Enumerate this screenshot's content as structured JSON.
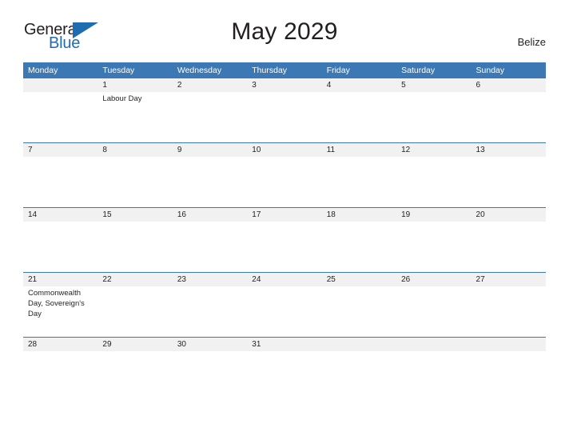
{
  "brand": {
    "name_part1": "General",
    "name_part2": "Blue",
    "triangle_color": "#1f6cb0"
  },
  "header": {
    "title": "May 2029",
    "country": "Belize"
  },
  "colors": {
    "header_blue": "#3c78b4",
    "date_band": "#f1f1f1",
    "text": "#231f20",
    "page_background": "#ffffff"
  },
  "calendar": {
    "day_headers": [
      "Monday",
      "Tuesday",
      "Wednesday",
      "Thursday",
      "Friday",
      "Saturday",
      "Sunday"
    ],
    "weeks": [
      {
        "days": [
          {
            "date": "",
            "event": ""
          },
          {
            "date": "1",
            "event": "Labour Day"
          },
          {
            "date": "2",
            "event": ""
          },
          {
            "date": "3",
            "event": ""
          },
          {
            "date": "4",
            "event": ""
          },
          {
            "date": "5",
            "event": ""
          },
          {
            "date": "6",
            "event": ""
          }
        ]
      },
      {
        "days": [
          {
            "date": "7",
            "event": ""
          },
          {
            "date": "8",
            "event": ""
          },
          {
            "date": "9",
            "event": ""
          },
          {
            "date": "10",
            "event": ""
          },
          {
            "date": "11",
            "event": ""
          },
          {
            "date": "12",
            "event": ""
          },
          {
            "date": "13",
            "event": ""
          }
        ]
      },
      {
        "days": [
          {
            "date": "14",
            "event": ""
          },
          {
            "date": "15",
            "event": ""
          },
          {
            "date": "16",
            "event": ""
          },
          {
            "date": "17",
            "event": ""
          },
          {
            "date": "18",
            "event": ""
          },
          {
            "date": "19",
            "event": ""
          },
          {
            "date": "20",
            "event": ""
          }
        ]
      },
      {
        "days": [
          {
            "date": "21",
            "event": "Commonwealth Day, Sovereign's Day"
          },
          {
            "date": "22",
            "event": ""
          },
          {
            "date": "23",
            "event": ""
          },
          {
            "date": "24",
            "event": ""
          },
          {
            "date": "25",
            "event": ""
          },
          {
            "date": "26",
            "event": ""
          },
          {
            "date": "27",
            "event": ""
          }
        ]
      },
      {
        "short": true,
        "days": [
          {
            "date": "28",
            "event": ""
          },
          {
            "date": "29",
            "event": ""
          },
          {
            "date": "30",
            "event": ""
          },
          {
            "date": "31",
            "event": ""
          },
          {
            "date": "",
            "event": ""
          },
          {
            "date": "",
            "event": ""
          },
          {
            "date": "",
            "event": ""
          }
        ]
      }
    ]
  }
}
